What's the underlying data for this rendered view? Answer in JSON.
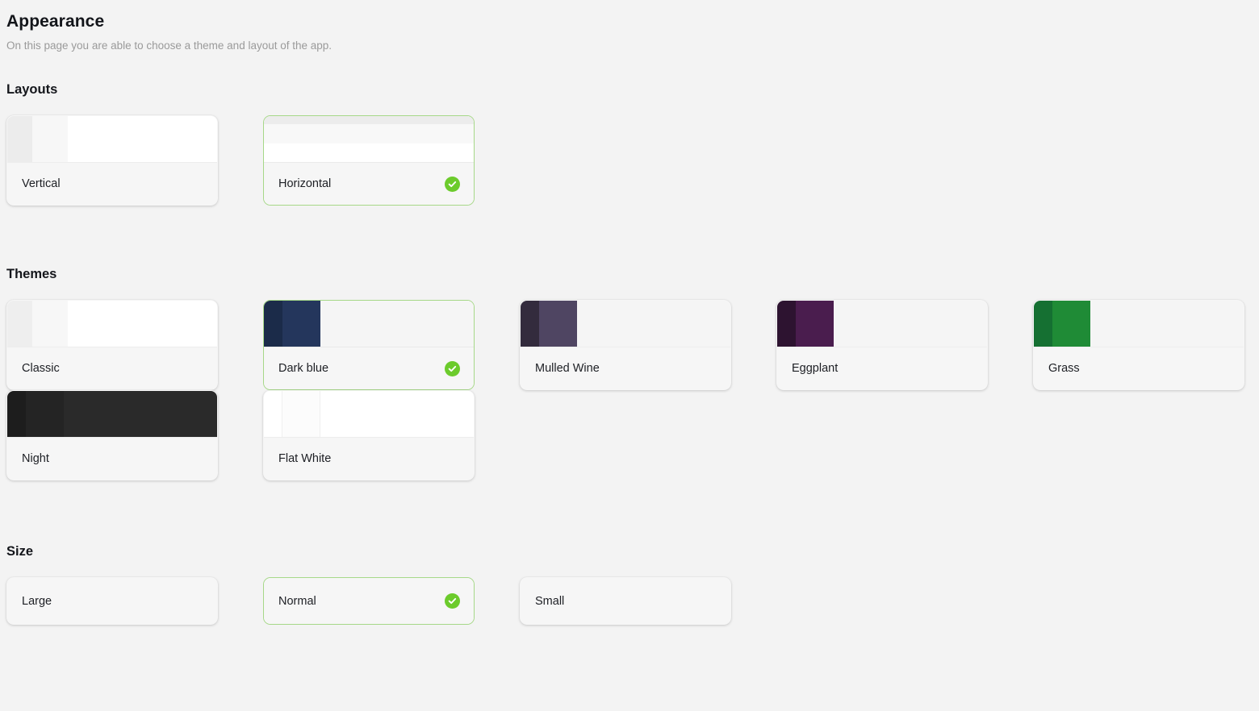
{
  "header": {
    "title": "Appearance",
    "subtitle": "On this page you are able to choose a theme and layout of the app."
  },
  "accent": {
    "selected_border": "#a6d888",
    "check_green": "#6ccb2c",
    "page_bg": "#f3f3f3",
    "card_bg": "#f6f6f6"
  },
  "sections": {
    "layouts": {
      "title": "Layouts",
      "items": [
        {
          "label": "Vertical",
          "selected": false,
          "orientation": "vertical",
          "bands": [
            {
              "color": "#ececec",
              "size": "12%"
            },
            {
              "color": "#f7f7f7",
              "size": "17%"
            },
            {
              "color": "#ffffff",
              "size": "71%"
            }
          ]
        },
        {
          "label": "Horizontal",
          "selected": true,
          "orientation": "horizontal",
          "bands": [
            {
              "color": "#ececec",
              "size": "17%"
            },
            {
              "color": "#f8f8f8",
              "size": "43%"
            },
            {
              "color": "#ffffff",
              "size": "40%"
            }
          ]
        }
      ]
    },
    "themes": {
      "title": "Themes",
      "items": [
        {
          "label": "Classic",
          "selected": false,
          "orientation": "vertical",
          "bands": [
            {
              "color": "#eeeeee",
              "size": "12%"
            },
            {
              "color": "#f7f7f7",
              "size": "17%"
            },
            {
              "color": "#ffffff",
              "size": "71%"
            }
          ]
        },
        {
          "label": "Dark blue",
          "selected": true,
          "orientation": "vertical",
          "bands": [
            {
              "color": "#1b2b49",
              "size": "9%"
            },
            {
              "color": "#24365c",
              "size": "18%"
            },
            {
              "color": "#f5f5f5",
              "size": "73%"
            }
          ]
        },
        {
          "label": "Mulled Wine",
          "selected": false,
          "orientation": "vertical",
          "bands": [
            {
              "color": "#332b3d",
              "size": "9%"
            },
            {
              "color": "#4f4562",
              "size": "18%"
            },
            {
              "color": "#f5f5f5",
              "size": "73%"
            }
          ]
        },
        {
          "label": "Eggplant",
          "selected": false,
          "orientation": "vertical",
          "bands": [
            {
              "color": "#2d1330",
              "size": "9%"
            },
            {
              "color": "#4a1d4e",
              "size": "18%"
            },
            {
              "color": "#f5f5f5",
              "size": "73%"
            }
          ]
        },
        {
          "label": "Grass",
          "selected": false,
          "orientation": "vertical",
          "bands": [
            {
              "color": "#157032",
              "size": "9%"
            },
            {
              "color": "#1f8b36",
              "size": "18%"
            },
            {
              "color": "#f5f5f5",
              "size": "73%"
            }
          ]
        },
        {
          "label": "Night",
          "selected": false,
          "orientation": "vertical",
          "bands": [
            {
              "color": "#1d1d1d",
              "size": "9%"
            },
            {
              "color": "#242424",
              "size": "18%"
            },
            {
              "color": "#2a2a2a",
              "size": "73%"
            }
          ]
        },
        {
          "label": "Flat White",
          "selected": false,
          "orientation": "vertical",
          "bands": [
            {
              "color": "#ffffff",
              "size": "9%"
            },
            {
              "color": "#fcfcfc",
              "size": "18%"
            },
            {
              "color": "#ffffff",
              "size": "73%"
            }
          ]
        }
      ]
    },
    "size": {
      "title": "Size",
      "items": [
        {
          "label": "Large",
          "selected": false
        },
        {
          "label": "Normal",
          "selected": true
        },
        {
          "label": "Small",
          "selected": false
        }
      ]
    }
  }
}
